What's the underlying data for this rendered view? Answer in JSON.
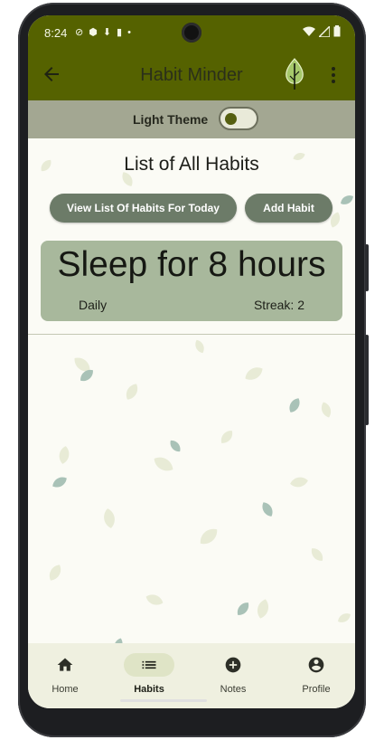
{
  "status_bar": {
    "time": "8:24"
  },
  "app_bar": {
    "title": "Habit Minder"
  },
  "theme_toggle": {
    "label": "Light Theme",
    "checked": false
  },
  "page": {
    "title": "List of All Habits",
    "buttons": {
      "view_today": "View List Of Habits For Today",
      "add_habit": "Add Habit"
    }
  },
  "habits": [
    {
      "name": "Sleep for 8 hours",
      "frequency": "Daily",
      "streak": "Streak: 2"
    }
  ],
  "bottom_nav": {
    "items": [
      {
        "label": "Home",
        "icon": "home-icon",
        "active": false
      },
      {
        "label": "Habits",
        "icon": "list-icon",
        "active": true
      },
      {
        "label": "Notes",
        "icon": "add-circle-icon",
        "active": false
      },
      {
        "label": "Profile",
        "icon": "account-circle-icon",
        "active": false
      }
    ]
  },
  "colors": {
    "app_bar": "#556200",
    "theme_row": "#a3a792",
    "button": "#6c7b68",
    "habit_card": "#a8b89c",
    "nav_background": "#eff0e0",
    "nav_active_pill": "#dfe4c6"
  }
}
